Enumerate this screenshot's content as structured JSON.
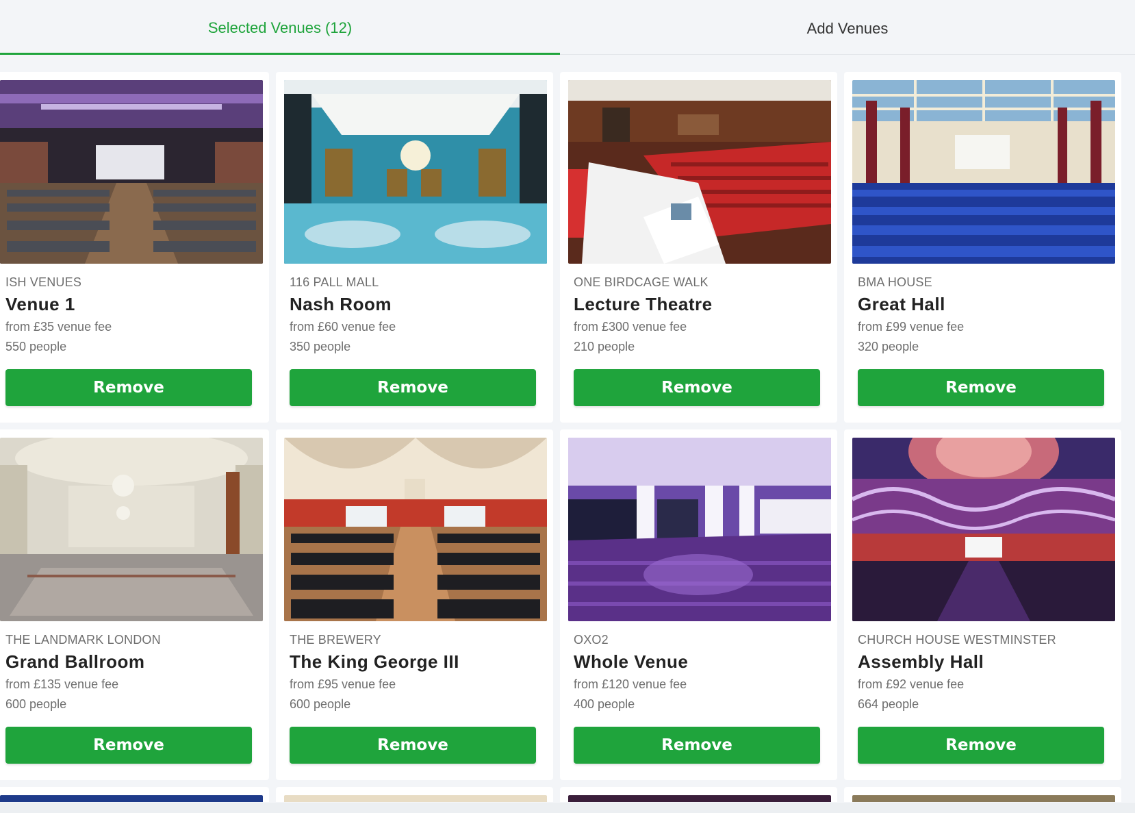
{
  "tabs": {
    "selected_label": "Selected Venues (12)",
    "add_label": "Add Venues"
  },
  "colors": {
    "accent": "#1fa43c"
  },
  "venues": [
    {
      "group": "ISH VENUES",
      "name": "Venue 1",
      "fee": "from £35 venue fee",
      "capacity": "550 people",
      "button": "Remove",
      "image": "auditorium-stage-chairs"
    },
    {
      "group": "116 PALL MALL",
      "name": "Nash Room",
      "fee": "from £60 venue fee",
      "capacity": "350 people",
      "button": "Remove",
      "image": "chandelier-dining-room"
    },
    {
      "group": "ONE BIRDCAGE WALK",
      "name": "Lecture Theatre",
      "fee": "from £300 venue fee",
      "capacity": "210 people",
      "button": "Remove",
      "image": "red-seat-lecture-theatre"
    },
    {
      "group": "BMA HOUSE",
      "name": "Great Hall",
      "fee": "from £99 venue fee",
      "capacity": "320 people",
      "button": "Remove",
      "image": "blue-seat-great-hall"
    },
    {
      "group": "THE LANDMARK LONDON",
      "name": "Grand Ballroom",
      "fee": "from £135 venue fee",
      "capacity": "600 people",
      "button": "Remove",
      "image": "empty-ballroom-chandelier"
    },
    {
      "group": "THE BREWERY",
      "name": "The King George III",
      "fee": "from £95 venue fee",
      "capacity": "600 people",
      "button": "Remove",
      "image": "vaulted-hall-chairs"
    },
    {
      "group": "OXO2",
      "name": "Whole Venue",
      "fee": "from £120 venue fee",
      "capacity": "400 people",
      "button": "Remove",
      "image": "purple-lit-open-space"
    },
    {
      "group": "CHURCH HOUSE WESTMINSTER",
      "name": "Assembly Hall",
      "fee": "from £92 venue fee",
      "capacity": "664 people",
      "button": "Remove",
      "image": "domed-assembly-hall"
    }
  ],
  "partial_row_images": [
    "blue-hall",
    "cream-room",
    "dark-purple-room",
    "warm-lit-room"
  ]
}
